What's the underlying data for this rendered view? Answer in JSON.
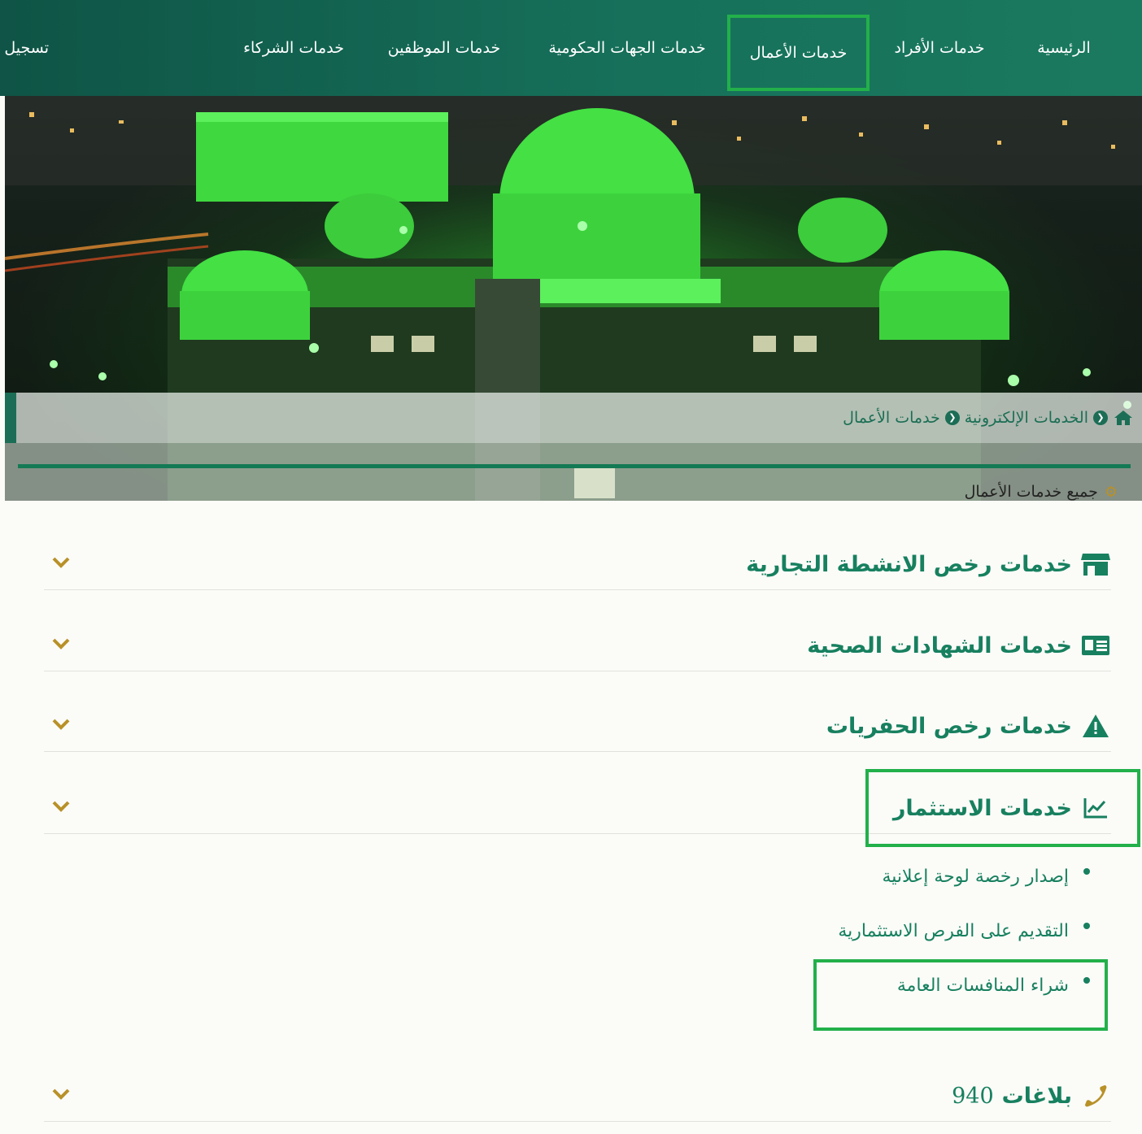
{
  "nav": {
    "home": "الرئيسية",
    "individuals": "خدمات الأفراد",
    "business": "خدمات الأعمال",
    "government": "خدمات الجهات الحكومية",
    "employees": "خدمات الموظفين",
    "partners": "خدمات الشركاء",
    "register": "تسجيل"
  },
  "breadcrumb": {
    "eservices": "الخدمات الإلكترونية",
    "current": "خدمات الأعمال"
  },
  "section": {
    "all_services": "جميع خدمات الأعمال"
  },
  "accordion": [
    {
      "title": "خدمات رخص الانشطة التجارية",
      "icon": "store-icon",
      "expanded": false
    },
    {
      "title": "خدمات الشهادات الصحية",
      "icon": "id-card-icon",
      "expanded": false
    },
    {
      "title": "خدمات رخص الحفريات",
      "icon": "warning-icon",
      "expanded": false
    },
    {
      "title": "خدمات الاستثمار",
      "icon": "chart-line-icon",
      "expanded": true,
      "items": [
        "إصدار رخصة لوحة إعلانية",
        "التقديم على الفرص الاستثمارية",
        "شراء المنافسات العامة"
      ]
    },
    {
      "title": "بلاغات",
      "number": "940",
      "icon": "phone-icon",
      "expanded": false
    }
  ],
  "colors": {
    "nav_bg": "#16705a",
    "accent_green": "#17805f",
    "highlight": "#22b04a",
    "chevron": "#b89128"
  }
}
